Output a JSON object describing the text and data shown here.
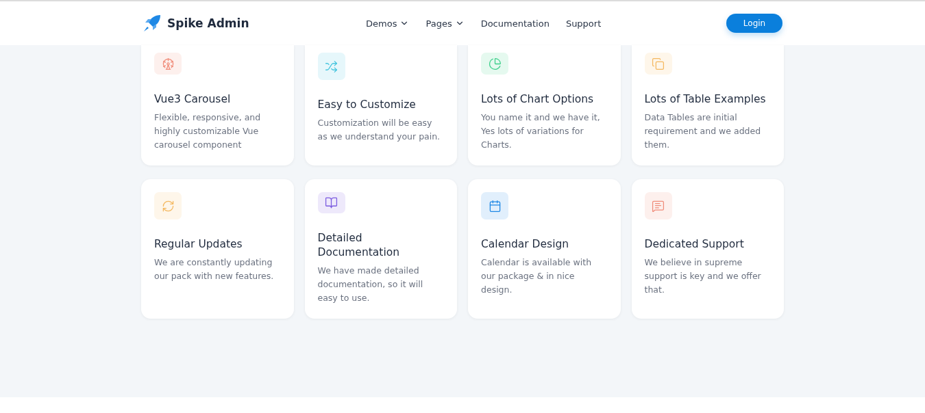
{
  "header": {
    "brand": "Spike Admin",
    "nav": [
      {
        "label": "Demos",
        "dropdown": true
      },
      {
        "label": "Pages",
        "dropdown": true
      },
      {
        "label": "Documentation",
        "dropdown": false
      },
      {
        "label": "Support",
        "dropdown": false
      }
    ],
    "login": "Login"
  },
  "features": [
    {
      "kind": "carousel",
      "color": "#f08c7a",
      "title": "Vue3 Carousel",
      "text": "Flexible, responsive, and highly customizable Vue carousel component"
    },
    {
      "kind": "shuffle",
      "color": "#46c5de",
      "title": "Easy to Customize",
      "text": "Customization will be easy as we understand your pain."
    },
    {
      "kind": "chart",
      "color": "#3ccf8a",
      "title": "Lots of Chart Options",
      "text": "You name it and we have it, Yes lots of variations for Charts."
    },
    {
      "kind": "copy",
      "color": "#f4b860",
      "title": "Lots of Table Examples",
      "text": "Data Tables are initial requirement and we added them."
    },
    {
      "kind": "refresh",
      "color": "#f4b860",
      "title": "Regular Updates",
      "text": "We are constantly updating our pack with new features."
    },
    {
      "kind": "book",
      "color": "#7c5ce0",
      "title": "Detailed Documentation",
      "text": "We have made detailed documentation, so it will easy to use."
    },
    {
      "kind": "calendar",
      "color": "#1e88e5",
      "title": "Calendar Design",
      "text": "Calendar is available with our package & in nice design."
    },
    {
      "kind": "message",
      "color": "#f08c7a",
      "title": "Dedicated Support",
      "text": "We believe in supreme support is key and we offer that."
    }
  ]
}
